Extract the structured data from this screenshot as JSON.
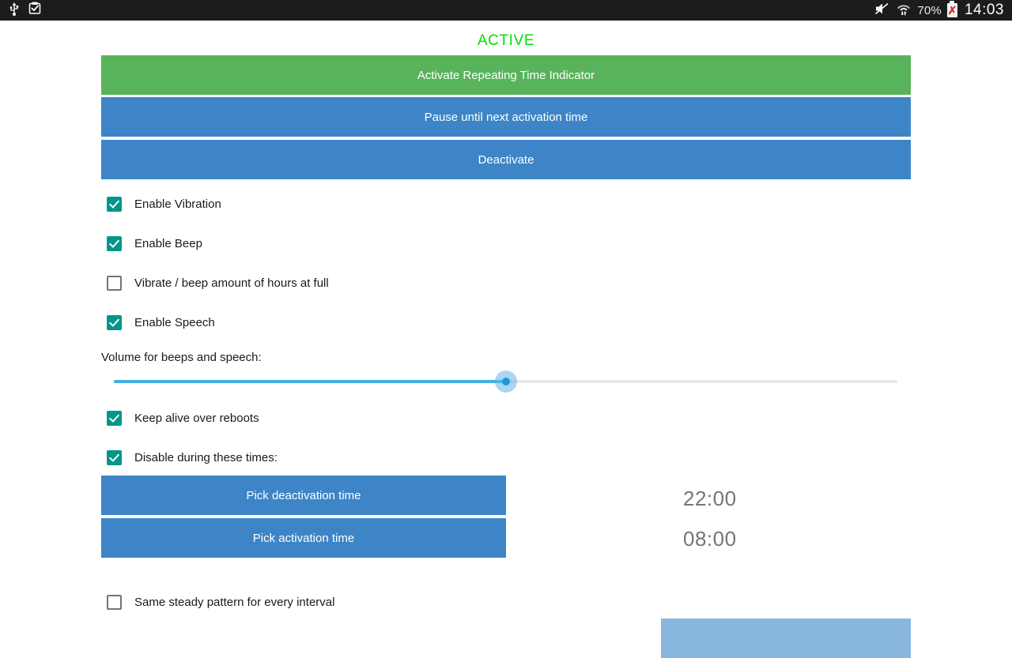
{
  "statusbar": {
    "left_icons": [
      "usb-icon",
      "clipboard-check-icon"
    ],
    "right_icons": [
      "mute-icon",
      "wifi-icon"
    ],
    "battery_percent": "70%",
    "battery_state": "battery-error-icon",
    "clock": "14:03"
  },
  "screen": {
    "status_label": "ACTIVE",
    "status_color": "#00e000"
  },
  "actions": {
    "activate": "Activate Repeating Time Indicator",
    "pause": "Pause until next activation time",
    "deactivate": "Deactivate"
  },
  "options": [
    {
      "label": "Enable Vibration",
      "checked": true
    },
    {
      "label": "Enable Beep",
      "checked": true
    },
    {
      "label": "Vibrate / beep amount of hours at full",
      "checked": false
    },
    {
      "label": "Enable Speech",
      "checked": true
    }
  ],
  "volume": {
    "label": "Volume for beeps and speech:",
    "value": 50,
    "min": 0,
    "max": 100,
    "fill_color": "#42aee0",
    "thumb_color": "#2196d6"
  },
  "options2": [
    {
      "label": "Keep alive over reboots",
      "checked": true
    },
    {
      "label": "Disable during these times:",
      "checked": true
    }
  ],
  "time_pickers": [
    {
      "button": "Pick deactivation time",
      "value": "22:00"
    },
    {
      "button": "Pick activation time",
      "value": "08:00"
    }
  ],
  "options3": [
    {
      "label": "Same steady pattern for every interval",
      "checked": false
    }
  ],
  "bottom_button": {
    "label": "",
    "color": "#89b6dd"
  },
  "colors": {
    "green": "#58b35a",
    "blue": "#3d85c6",
    "teal": "#009688",
    "grey_text": "#757575"
  }
}
